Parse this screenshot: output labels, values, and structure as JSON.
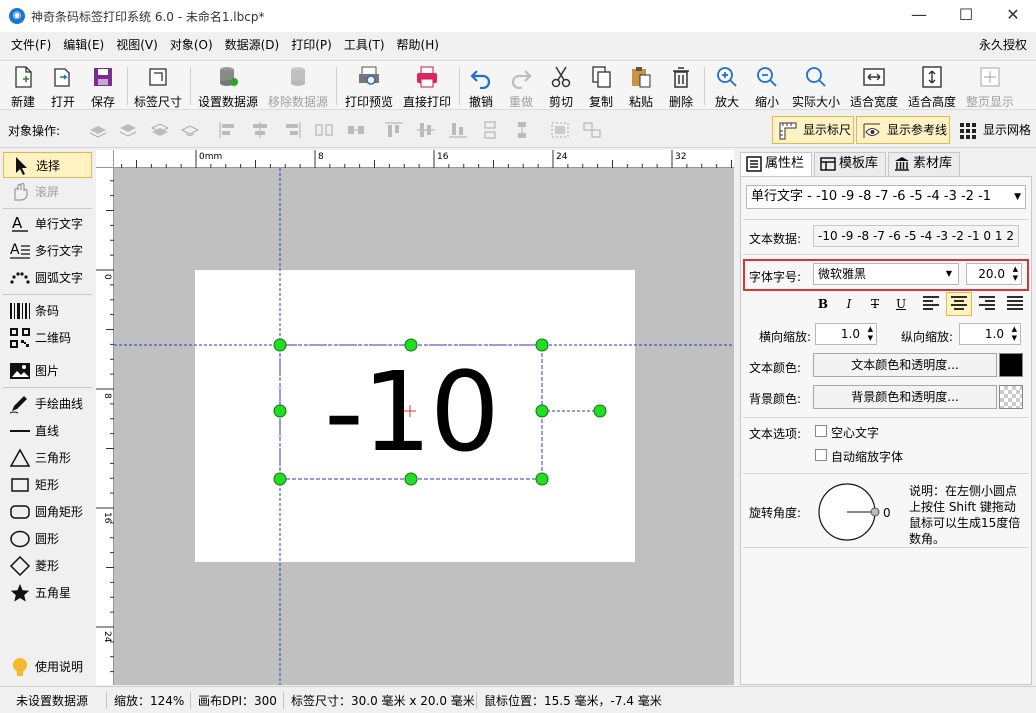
{
  "window": {
    "title": "神奇条码标签打印系统 6.0 - 未命名1.lbcp*",
    "app_icon": "app-icon"
  },
  "menu": {
    "items": [
      "文件(F)",
      "编辑(E)",
      "视图(V)",
      "对象(O)",
      "数据源(D)",
      "打印(P)",
      "工具(T)",
      "帮助(H)"
    ],
    "license": "永久授权"
  },
  "toolbar": {
    "new": "新建",
    "open": "打开",
    "save": "保存",
    "label_size": "标签尺寸",
    "set_datasource": "设置数据源",
    "remove_datasource": "移除数据源",
    "print_preview": "打印预览",
    "direct_print": "直接打印",
    "undo": "撤销",
    "redo": "重做",
    "cut": "剪切",
    "copy": "复制",
    "paste": "粘贴",
    "delete": "删除",
    "zoom_in": "放大",
    "zoom_out": "缩小",
    "actual_size": "实际大小",
    "fit_width": "适合宽度",
    "fit_height": "适合高度",
    "full_page": "整页显示"
  },
  "objbar": {
    "label": "对象操作:",
    "show_ruler": "显示标尺",
    "show_guides": "显示参考线",
    "show_grid": "显示网格"
  },
  "tools": {
    "select": "选择",
    "scroll": "滚屏",
    "single_text": "单行文字",
    "multi_text": "多行文字",
    "arc_text": "圆弧文字",
    "barcode": "条码",
    "qrcode": "二维码",
    "image": "图片",
    "freehand": "手绘曲线",
    "line": "直线",
    "triangle": "三角形",
    "rect": "矩形",
    "round_rect": "圆角矩形",
    "ellipse": "圆形",
    "diamond": "菱形",
    "star": "五角星",
    "help": "使用说明"
  },
  "ruler": {
    "unit": "mm",
    "top_labels": [
      "0",
      "8",
      "16",
      "24",
      "32"
    ],
    "left_labels": [
      "0",
      "8",
      "16",
      "24"
    ]
  },
  "canvas": {
    "text": "-10"
  },
  "panel": {
    "tabs": [
      "属性栏",
      "模板库",
      "素材库"
    ],
    "object_select": "单行文字 - -10 -9 -8 -7 -6 -5 -4 -3 -2 -1",
    "text_data_label": "文本数据:",
    "text_data_value": "-10 -9 -8 -7 -6 -5 -4 -3 -2 -1 0 1 2 ...",
    "font_label": "字体字号:",
    "font_name": "微软雅黑",
    "font_size": "20.0",
    "hscale_label": "横向缩放:",
    "hscale": "1.0",
    "vscale_label": "纵向缩放:",
    "vscale": "1.0",
    "text_color_label": "文本颜色:",
    "text_color_btn": "文本颜色和透明度...",
    "bg_color_label": "背景颜色:",
    "bg_color_btn": "背景颜色和透明度...",
    "text_options_label": "文本选项:",
    "hollow_text": "空心文字",
    "auto_shrink": "自动缩放字体",
    "rotation_label": "旋转角度:",
    "rotation_value": "0",
    "rotation_note": "说明：在左侧小圆点上按住 Shift 键拖动鼠标可以生成15度倍数角。",
    "text_color": "#000000"
  },
  "status": {
    "datasource": "未设置数据源",
    "zoom": "缩放：124%",
    "dpi": "画布DPI：300",
    "label_size": "标签尺寸：30.0 毫米 x 20.0 毫米",
    "mouse_pos": "鼠标位置：15.5 毫米，-7.4 毫米"
  },
  "colors": {
    "selection": "#22dd22",
    "guide": "#3333cc",
    "highlight_border": "#d9343a"
  }
}
